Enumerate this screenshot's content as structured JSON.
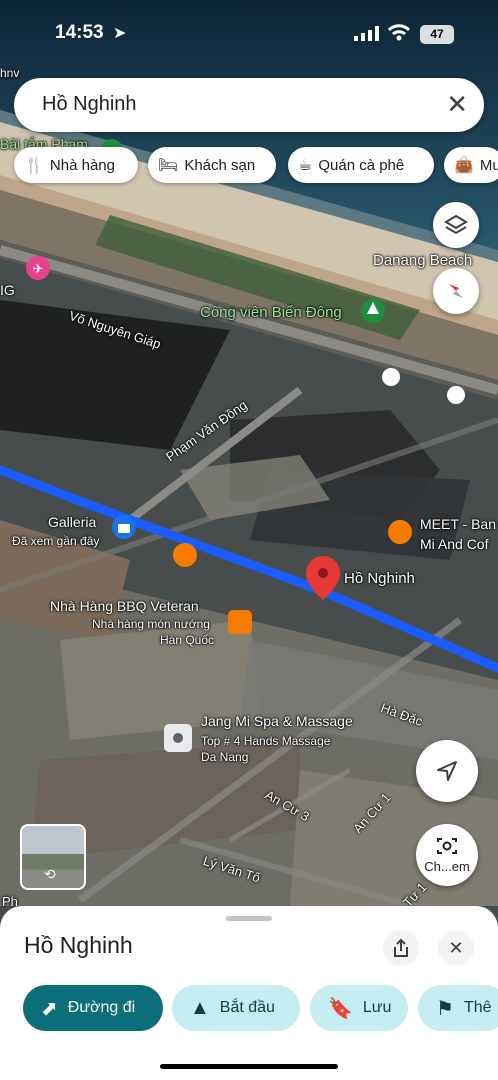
{
  "status_bar": {
    "time": "14:53",
    "battery": "47"
  },
  "search": {
    "query": "Hồ Nghinh"
  },
  "chips": [
    {
      "label": "Nhà hàng",
      "icon": "fork-knife-icon"
    },
    {
      "label": "Khách sạn",
      "icon": "bed-icon"
    },
    {
      "label": "Quán cà phê",
      "icon": "coffee-icon"
    },
    {
      "label": "Mu",
      "icon": "shopping-bag-icon"
    }
  ],
  "map_labels": {
    "hnv": "hnv",
    "bai_tam": "Bãi tắm Phạm",
    "ig": "IG",
    "vo_nguyen_giap": "Võ Nguyên Giáp",
    "cong_vien": "Công viên Biển Đông",
    "danang_beach": "Danang Beach",
    "pham_van_dong": "Phạm Văn Đồng",
    "galleria": "Galleria",
    "galleria_sub": "Đã xem gần đây",
    "meet": "MEET - Ban",
    "meet_sub": "Mi And Cof",
    "ho_nghinh": "Hồ Nghinh",
    "bbq": "Nhà Hàng BBQ Veteran",
    "bbq_sub1": "Nhà hàng món nướng",
    "bbq_sub2": "Hàn Quốc",
    "ha_dac": "Hà Đặc",
    "jang_mi": "Jang Mi Spa & Massage",
    "jang_mi_sub1": "Top # 4 Hands Massage",
    "jang_mi_sub2": "Da Nang",
    "an_cu_3": "An Cư 3",
    "an_cu_1": "An Cư 1",
    "ly_van_to": "Lý Văn Tố",
    "tu": "Tư 1",
    "ph": "Ph"
  },
  "street_view_button": {
    "label": "Ch...em"
  },
  "place_sheet": {
    "title": "Hồ Nghinh",
    "actions": [
      {
        "label": "Đường đi",
        "icon": "directions-icon"
      },
      {
        "label": "Bắt đầu",
        "icon": "navigation-arrow-icon"
      },
      {
        "label": "Lưu",
        "icon": "bookmark-icon"
      },
      {
        "label": "Thê",
        "icon": "flag-icon"
      }
    ]
  },
  "colors": {
    "route": "#1a5cff",
    "pin": "#e53935",
    "primary_button": "#0b6e78",
    "secondary_button": "#c5eef3"
  }
}
